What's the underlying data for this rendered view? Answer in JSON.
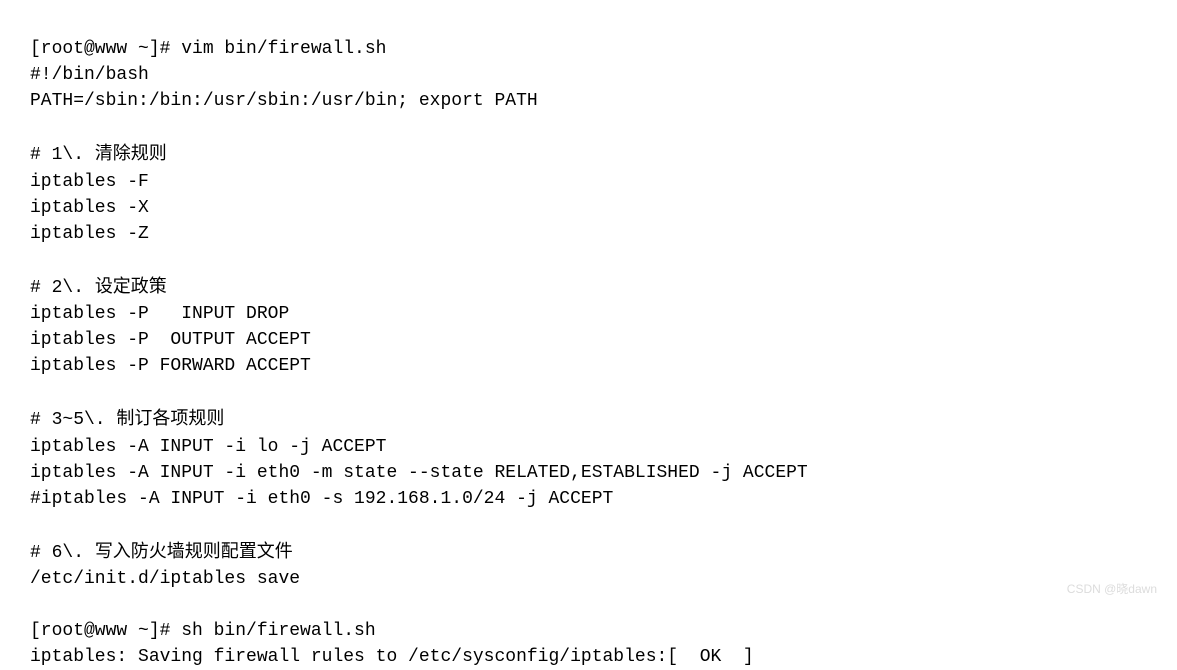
{
  "terminal": {
    "lines": {
      "l0": "[root@www ~]# vim bin/firewall.sh",
      "l1": "#!/bin/bash",
      "l2": "PATH=/sbin:/bin:/usr/sbin:/usr/bin; export PATH",
      "l3": "",
      "l4_prefix": "# 1\\. ",
      "l4_cjk": "清除规则",
      "l5": "iptables -F",
      "l6": "iptables -X",
      "l7": "iptables -Z",
      "l8": "",
      "l9_prefix": "# 2\\. ",
      "l9_cjk": "设定政策",
      "l10": "iptables -P   INPUT DROP",
      "l11": "iptables -P  OUTPUT ACCEPT",
      "l12": "iptables -P FORWARD ACCEPT",
      "l13": "",
      "l14_prefix": "# 3~5\\. ",
      "l14_cjk": "制订各项规则",
      "l15": "iptables -A INPUT -i lo -j ACCEPT",
      "l16": "iptables -A INPUT -i eth0 -m state --state RELATED,ESTABLISHED -j ACCEPT",
      "l17": "#iptables -A INPUT -i eth0 -s 192.168.1.0/24 -j ACCEPT",
      "l18": "",
      "l19_prefix": "# 6\\. ",
      "l19_cjk": "写入防火墙规则配置文件",
      "l20": "/etc/init.d/iptables save",
      "l21": "",
      "l22": "[root@www ~]# sh bin/firewall.sh",
      "l23": "iptables: Saving firewall rules to /etc/sysconfig/iptables:[  OK  ]"
    }
  },
  "watermark": "CSDN @晓dawn"
}
